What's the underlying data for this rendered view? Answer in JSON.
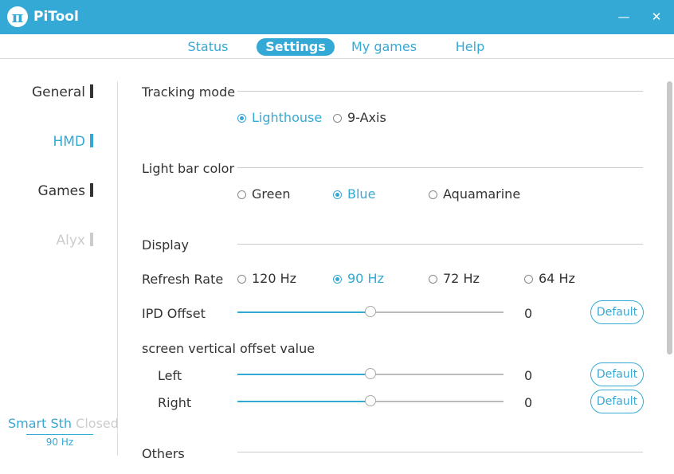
{
  "app": {
    "title": "PiTool",
    "logo_glyph": "π",
    "minimize_glyph": "—",
    "close_glyph": "✕"
  },
  "tabs": [
    {
      "label": "Status",
      "active": false
    },
    {
      "label": "Settings",
      "active": true
    },
    {
      "label": "My games",
      "active": false
    },
    {
      "label": "Help",
      "active": false
    }
  ],
  "sidebar": {
    "items": [
      {
        "label": "General",
        "state": "normal"
      },
      {
        "label": "HMD",
        "state": "active"
      },
      {
        "label": "Games",
        "state": "normal"
      },
      {
        "label": "Alyx",
        "state": "disabled"
      }
    ],
    "status": {
      "smart_label": "Smart Sth",
      "smart_state": "Closed",
      "refresh": "90 Hz"
    }
  },
  "tracking": {
    "title": "Tracking mode",
    "options": [
      "Lighthouse",
      "9-Axis"
    ],
    "selected": "Lighthouse"
  },
  "light_bar": {
    "title": "Light bar color",
    "options": [
      "Green",
      "Blue",
      "Aquamarine"
    ],
    "selected": "Blue"
  },
  "display": {
    "title": "Display",
    "refresh_rate": {
      "label": "Refresh Rate",
      "options": [
        "120 Hz",
        "90 Hz",
        "72 Hz",
        "64 Hz"
      ],
      "selected": "90 Hz"
    },
    "ipd_offset": {
      "label": "IPD Offset",
      "value": "0",
      "level": 0.5,
      "default_label": "Default"
    },
    "vertical_offset": {
      "label": "screen vertical offset value",
      "left": {
        "label": "Left",
        "value": "0",
        "level": 0.5,
        "default_label": "Default"
      },
      "right": {
        "label": "Right",
        "value": "0",
        "level": 0.5,
        "default_label": "Default"
      }
    }
  },
  "others": {
    "title": "Others"
  },
  "colors": {
    "accent": "#35a9d6",
    "text": "#333333",
    "disabled": "#cccccc"
  }
}
